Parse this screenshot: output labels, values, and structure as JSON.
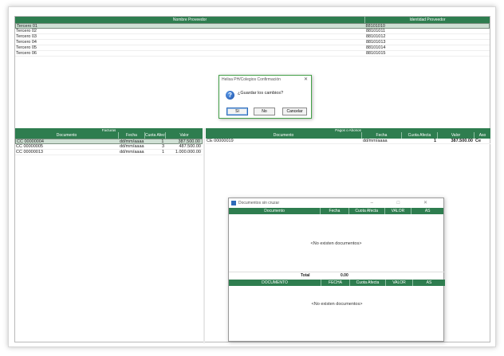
{
  "providers": {
    "headers": [
      "Nombre Proveedor",
      "Identidad Proveedor"
    ],
    "rows": [
      {
        "name": "Tercero 01",
        "id": "88101010"
      },
      {
        "name": "Tercero 02",
        "id": "88101011"
      },
      {
        "name": "Tercero 03",
        "id": "88101012"
      },
      {
        "name": "Tercero 04",
        "id": "88101013"
      },
      {
        "name": "Tercero 05",
        "id": "88101014"
      },
      {
        "name": "Tercero 06",
        "id": "88101015"
      }
    ]
  },
  "facturas": {
    "title": "Facturas",
    "headers": [
      "Documento",
      "Fecha",
      "Cuota Afecta",
      "Valor"
    ],
    "rows": [
      {
        "doc": "CC 00000004",
        "fecha": "dd/mm/aaaa",
        "cuota": "1",
        "valor": "387.500.00"
      },
      {
        "doc": "CC 00000005",
        "fecha": "dd/mm/aaaa",
        "cuota": "3",
        "valor": "487.500.00"
      },
      {
        "doc": "CC 00000013",
        "fecha": "dd/mm/aaaa",
        "cuota": "1",
        "valor": "1.000.000.00"
      }
    ]
  },
  "pagos": {
    "title": "Pagos o Abonos",
    "headers": [
      "Documento",
      "Fecha",
      "Cuota Afecta",
      "Valor",
      "Aso"
    ],
    "rows": [
      {
        "doc": "CE 00000019",
        "fecha": "dd/mm/aaaa",
        "cuota": "1",
        "valor": "387.500.00",
        "aso": "Ce"
      }
    ]
  },
  "confirm": {
    "title": "Helisa PH/Colegios Confirmación",
    "close": "✕",
    "message": "¿Guardar los cambios?",
    "buttons": [
      "Sí",
      "No",
      "Cancelar"
    ]
  },
  "docs_window": {
    "title": "Documentos sin cruzar",
    "controls": "– □ ✕",
    "headers1": [
      "Documento",
      "Fecha",
      "Cuota Afecta",
      "VALOR",
      "AS"
    ],
    "empty1": "<No existen documentos>",
    "total_label": "Total",
    "total_value": "0.00",
    "headers2": [
      "DOCUMENTO",
      "FECHA",
      "Cuota Afecta",
      "VALOR",
      "AS"
    ],
    "empty2": "<No existen documentos>"
  },
  "colors": {
    "header_green": "#2e7d4f",
    "dialog_border": "#43a047"
  }
}
